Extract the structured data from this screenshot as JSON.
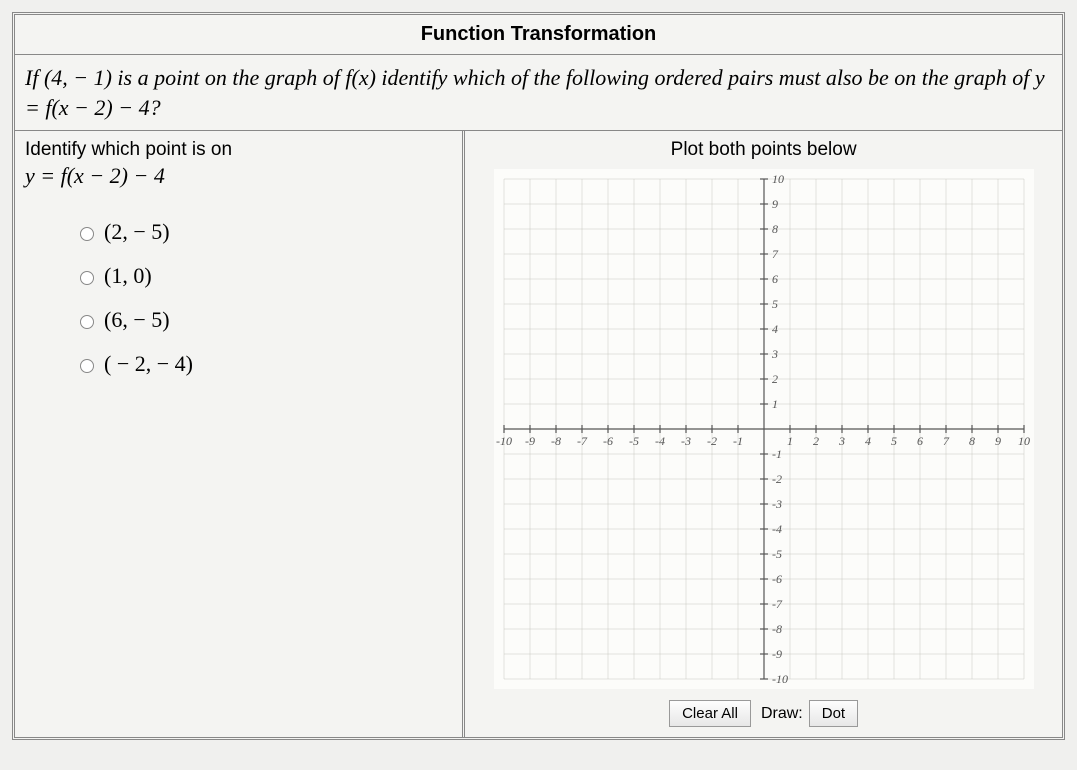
{
  "title": "Function Transformation",
  "question_html": "If (4, − 1) is a point on the graph of f(x) identify which of the following ordered pairs must also be on the graph of y = f(x − 2) − 4?",
  "identify": {
    "heading": "Identify which point is on",
    "equation": "y = f(x − 2) − 4"
  },
  "options": [
    "(2, − 5)",
    "(1, 0)",
    "(6, − 5)",
    "( − 2, − 4)"
  ],
  "plot_heading": "Plot both points below",
  "toolbar": {
    "clear_label": "Clear All",
    "draw_label": "Draw:",
    "dot_label": "Dot"
  },
  "chart_data": {
    "type": "scatter",
    "xlim": [
      -10,
      10
    ],
    "ylim": [
      -10,
      10
    ],
    "x_ticks": [
      -10,
      -9,
      -8,
      -7,
      -6,
      -5,
      -4,
      -3,
      -2,
      -1,
      1,
      2,
      3,
      4,
      5,
      6,
      7,
      8,
      9,
      10
    ],
    "y_ticks": [
      -10,
      -9,
      -8,
      -7,
      -6,
      -5,
      -4,
      -3,
      -2,
      -1,
      1,
      2,
      3,
      4,
      5,
      6,
      7,
      8,
      9,
      10
    ],
    "series": [
      {
        "name": "plotted-points",
        "values": []
      }
    ],
    "grid": true
  }
}
